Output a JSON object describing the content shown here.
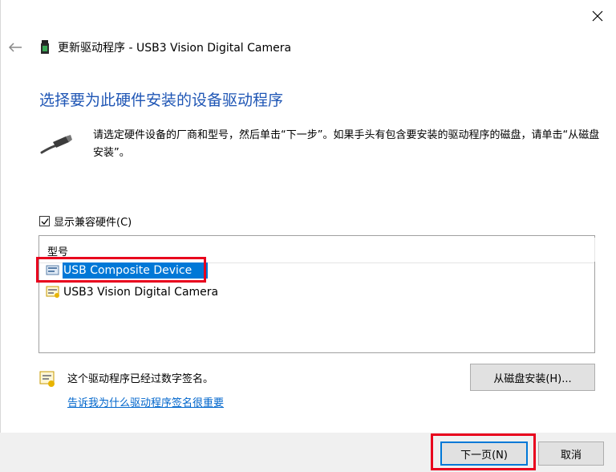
{
  "window": {
    "title": "更新驱动程序 - USB3 Vision Digital Camera",
    "close_icon": "close-icon",
    "back_icon": "back-arrow-icon"
  },
  "page": {
    "heading": "选择要为此硬件安装的设备驱动程序",
    "instructions": "请选定硬件设备的厂商和型号，然后单击“下一步”。如果手头有包含要安装的驱动程序的磁盘，请单击“从磁盘安装”。"
  },
  "compatible_checkbox": {
    "label": "显示兼容硬件(C)",
    "checked": true
  },
  "model_list": {
    "column_header": "型号",
    "items": [
      {
        "label": "USB Composite Device",
        "selected": true
      },
      {
        "label": "USB3 Vision Digital Camera",
        "selected": false
      }
    ]
  },
  "signature": {
    "status": "这个驱动程序已经过数字签名。",
    "link": "告诉我为什么驱动程序签名很重要"
  },
  "buttons": {
    "have_disk": "从磁盘安装(H)...",
    "next": "下一页(N)",
    "cancel": "取消"
  },
  "colors": {
    "accent": "#0078d7",
    "heading": "#1f56b5",
    "link": "#0066cc",
    "annotation": "#e8001d"
  }
}
